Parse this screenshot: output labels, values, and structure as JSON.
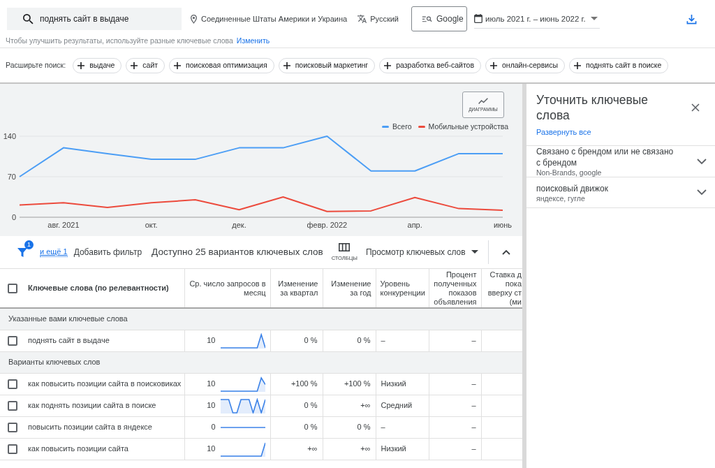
{
  "search_bar": {
    "query": "поднять сайт в выдаче",
    "location": "Соединенные Штаты Америки и Украина",
    "language": "Русский",
    "network": "Google",
    "date_range": "июль 2021 г. – июнь 2022 г."
  },
  "hint": {
    "text": "Чтобы улучшить результаты, используйте разные ключевые слова",
    "link": "Изменить"
  },
  "broaden_search": {
    "label": "Расширьте поиск:",
    "chips": [
      "выдаче",
      "сайт",
      "поисковая оптимизация",
      "поисковый маркетинг",
      "разработка веб-сайтов",
      "онлайн-сервисы",
      "поднять сайт в поиске"
    ]
  },
  "chart": {
    "button_label": "ДИАГРАММЫ",
    "chart_data": {
      "type": "line",
      "categories": [
        null,
        "авг. 2021",
        null,
        "окт.",
        null,
        "дек.",
        null,
        "февр. 2022",
        null,
        "апр.",
        null,
        "июнь"
      ],
      "ylim": [
        0,
        140
      ],
      "yticks": [
        0,
        70,
        140
      ],
      "legend": "top-right",
      "series": [
        {
          "name": "Всего",
          "color": "#4c9ef5",
          "values": [
            70,
            120,
            110,
            100,
            100,
            120,
            120,
            140,
            80,
            80,
            110,
            110
          ]
        },
        {
          "name": "Мобильные устройства",
          "color": "#ec4b3d",
          "values": [
            21,
            25,
            17,
            25,
            30,
            13,
            35,
            10,
            11,
            34,
            15,
            12
          ]
        }
      ]
    }
  },
  "toolbar": {
    "filter_count": "1",
    "more_filters": "и ещё 1",
    "add_filter": "Добавить фильтр",
    "summary": "Доступно 25 вариантов ключевых слов",
    "columns_label": "СТОЛБЦЫ",
    "view": "Просмотр ключевых слов"
  },
  "table": {
    "select_all_checked": false,
    "columns": [
      "Ключевые слова (по релевантности)",
      "Ср. число запросов в месяц",
      "Изменение за квартал",
      "Изменение за год",
      "Уровень конкуренции",
      "Процент полученных показов объявления",
      "Ставка д\nпока\nвверху ст\n(ми"
    ],
    "groups": [
      {
        "title": "Указанные вами ключевые слова",
        "rows": [
          {
            "keyword": "поднять сайт в выдаче",
            "checked": false,
            "avg_searches": "10",
            "sparkline": {
              "kind": "spike"
            },
            "quarter_change": "0 %",
            "year_change": "0 %",
            "competition": "–",
            "impression_share": "–"
          }
        ]
      },
      {
        "title": "Варианты ключевых слов",
        "rows": [
          {
            "keyword": "как повысить позиции сайта в поисковиках",
            "checked": false,
            "avg_searches": "10",
            "sparkline": {
              "kind": "peak"
            },
            "quarter_change": "+100 %",
            "year_change": "+100 %",
            "competition": "Низкий",
            "impression_share": "–"
          },
          {
            "keyword": "как поднять позиции сайта в поиске",
            "checked": false,
            "avg_searches": "10",
            "sparkline": {
              "kind": "zigzag"
            },
            "quarter_change": "0 %",
            "year_change": "+∞",
            "competition": "Средний",
            "impression_share": "–"
          },
          {
            "keyword": "повысить позиции сайта в яндексе",
            "checked": false,
            "avg_searches": "0",
            "sparkline": {
              "kind": "flat"
            },
            "quarter_change": "0 %",
            "year_change": "0 %",
            "competition": "–",
            "impression_share": "–"
          },
          {
            "keyword": "как повысить позиции сайта",
            "checked": false,
            "avg_searches": "10",
            "sparkline": {
              "kind": "rise"
            },
            "quarter_change": "+∞",
            "year_change": "+∞",
            "competition": "Низкий",
            "impression_share": "–"
          }
        ]
      }
    ]
  },
  "refine_panel": {
    "title": "Уточнить ключевые слова",
    "expand_all": "Развернуть все",
    "sections": [
      {
        "title": "Связано с брендом или не связано с брендом",
        "summary": "Non-Brands, google",
        "expanded": false
      },
      {
        "title": "поисковый движок",
        "summary": "яндексе, гугле",
        "expanded": false
      }
    ]
  }
}
